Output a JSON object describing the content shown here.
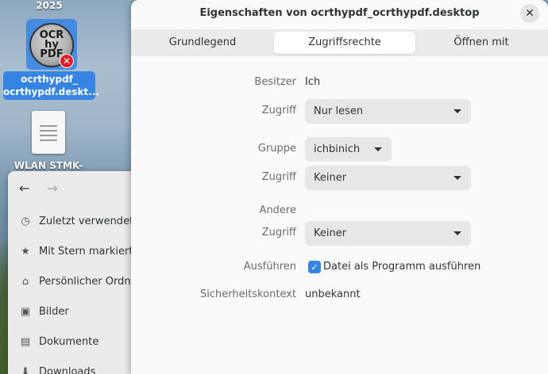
{
  "desktop": {
    "year_label": "2025",
    "selected_icon": {
      "text_line1": "OCR",
      "text_line2": "hy",
      "text_line3": "PDF",
      "badge": "✕",
      "label_line1": "ocrthypdf_",
      "label_line2": "ocrthypdf.deskt..."
    },
    "file_icon": {
      "label": "WLAN STMK-"
    }
  },
  "file_manager": {
    "back_icon": "←",
    "forward_icon": "→",
    "sidebar": [
      {
        "icon": "◷",
        "icon_name": "recent-icon",
        "label": "Zuletzt verwendet"
      },
      {
        "icon": "★",
        "icon_name": "star-icon",
        "label": "Mit Stern markiert"
      },
      {
        "icon": "⌂",
        "icon_name": "home-icon",
        "label": "Persönlicher Ordner"
      },
      {
        "icon": "▣",
        "icon_name": "pictures-icon",
        "label": "Bilder"
      },
      {
        "icon": "▤",
        "icon_name": "documents-icon",
        "label": "Dokumente"
      },
      {
        "icon": "⬇",
        "icon_name": "downloads-icon",
        "label": "Downloads"
      }
    ]
  },
  "dialog": {
    "title": "Eigenschaften von ocrthypdf_ocrthypdf.desktop",
    "close_icon": "✕",
    "tabs": [
      {
        "label": "Grundlegend",
        "active": false
      },
      {
        "label": "Zugriffsrechte",
        "active": true
      },
      {
        "label": "Öffnen mit",
        "active": false
      }
    ],
    "permissions": {
      "owner_label": "Besitzer",
      "owner_value": "Ich",
      "owner_access_label": "Zugriff",
      "owner_access_value": "Nur lesen",
      "group_label": "Gruppe",
      "group_value": "ichbinich",
      "group_access_label": "Zugriff",
      "group_access_value": "Keiner",
      "others_label": "Andere",
      "others_access_label": "Zugriff",
      "others_access_value": "Keiner",
      "execute_label": "Ausführen",
      "execute_checkbox_label": "Datei als Programm ausführen",
      "execute_checked": true,
      "checkmark": "✓",
      "security_label": "Sicherheitskontext",
      "security_value": "unbekannt"
    }
  },
  "colors": {
    "accent": "#3584e4",
    "dialog_bg": "#fafafa",
    "dropdown_bg": "#e7e7ea",
    "tabbar_bg": "#ebebeb"
  }
}
